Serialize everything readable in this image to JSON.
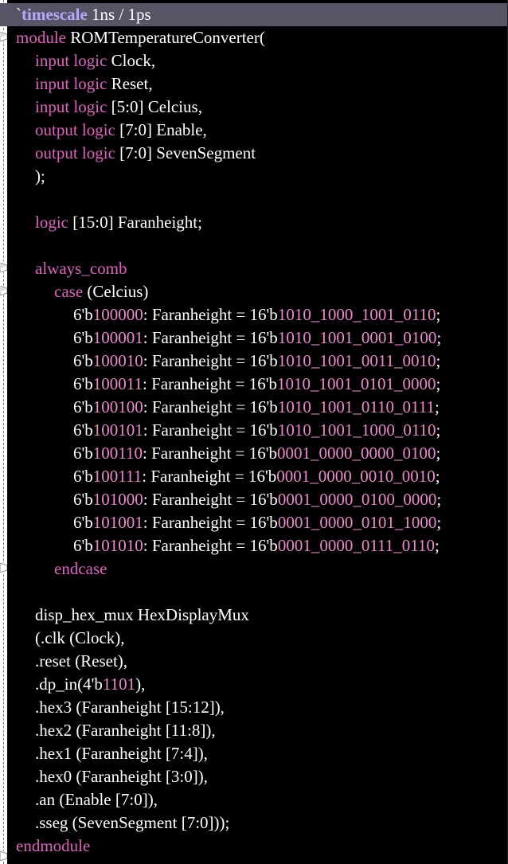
{
  "lines": {
    "l1": {
      "tick": "`",
      "kw": "timescale",
      "rest": " 1ns / 1ps"
    },
    "l2": {
      "kw": "module",
      "rest": " ROMTemperatureConverter("
    },
    "l3": {
      "kw": "input logic",
      "rest": " Clock,"
    },
    "l4": {
      "kw": "input logic",
      "rest": " Reset,"
    },
    "l5": {
      "kw": "input logic",
      "rest": " [5:0] Celcius,"
    },
    "l6": {
      "kw": "output logic",
      "rest": " [7:0] Enable,"
    },
    "l7": {
      "kw": "output logic",
      "rest": " [7:0] SevenSegment"
    },
    "l8": {
      "rest": ");"
    },
    "l9": {
      "rest": ""
    },
    "l10": {
      "kw": "logic",
      "rest": " [15:0] Faranheight;"
    },
    "l11": {
      "rest": ""
    },
    "l12": {
      "kw": "always_comb"
    },
    "l13": {
      "kw": "case",
      "rest": " (Celcius)"
    },
    "case_rows": [
      {
        "pre": "6'b",
        "sel": "100000",
        "mid": ": Faranheight = 16'b",
        "val": "1010_1000_1001_0110",
        "end": ";"
      },
      {
        "pre": "6'b",
        "sel": "100001",
        "mid": ": Faranheight = 16'b",
        "val": "1010_1001_0001_0100",
        "end": ";"
      },
      {
        "pre": "6'b",
        "sel": "100010",
        "mid": ": Faranheight = 16'b",
        "val": "1010_1001_0011_0010",
        "end": ";"
      },
      {
        "pre": "6'b",
        "sel": "100011",
        "mid": ": Faranheight = 16'b",
        "val": "1010_1001_0101_0000",
        "end": ";"
      },
      {
        "pre": "6'b",
        "sel": "100100",
        "mid": ": Faranheight = 16'b",
        "val": "1010_1001_0110_0111",
        "end": ";"
      },
      {
        "pre": "6'b",
        "sel": "100101",
        "mid": ": Faranheight = 16'b",
        "val": "1010_1001_1000_0110",
        "end": ";"
      },
      {
        "pre": "6'b",
        "sel": "100110",
        "mid": ": Faranheight = 16'b",
        "val": "0001_0000_0000_0100",
        "end": ";"
      },
      {
        "pre": "6'b",
        "sel": "100111",
        "mid": ": Faranheight = 16'b",
        "val": "0001_0000_0010_0010",
        "end": ";"
      },
      {
        "pre": "6'b",
        "sel": "101000",
        "mid": ": Faranheight = 16'b",
        "val": "0001_0000_0100_0000",
        "end": ";"
      },
      {
        "pre": "6'b",
        "sel": "101001",
        "mid": ": Faranheight = 16'b",
        "val": "0001_0000_0101_1000",
        "end": ";"
      },
      {
        "pre": "6'b",
        "sel": "101010",
        "mid": ": Faranheight = 16'b",
        "val": "0001_0000_0111_0110",
        "end": ";"
      }
    ],
    "l25": {
      "kw": "endcase"
    },
    "l26": {
      "rest": ""
    },
    "l27": {
      "rest": "disp_hex_mux HexDisplayMux"
    },
    "l28": {
      "rest": "(.clk (Clock),"
    },
    "l29": {
      "rest": ".reset (Reset),"
    },
    "l30": {
      "pre": ".dp_in(4'b",
      "num": "1101",
      "post": "),"
    },
    "l31": {
      "rest": ".hex3 (Faranheight [15:12]),"
    },
    "l32": {
      "rest": ".hex2 (Faranheight [11:8]),"
    },
    "l33": {
      "rest": ".hex1 (Faranheight [7:4]),"
    },
    "l34": {
      "rest": ".hex0 (Faranheight [3:0]),"
    },
    "l35": {
      "rest": ".an (Enable [7:0]),"
    },
    "l36": {
      "rest": ".sseg (SevenSegment [7:0]));"
    },
    "l37": {
      "kw": "endmodule"
    }
  },
  "colors": {
    "background": "#000000",
    "keyword": "#e060c0",
    "directive": "#b9a6ff",
    "number": "#ee88cc",
    "text": "#ffffff",
    "highlight": "#555566"
  },
  "icons": {
    "fold_marker": "fold-marker-icon"
  }
}
